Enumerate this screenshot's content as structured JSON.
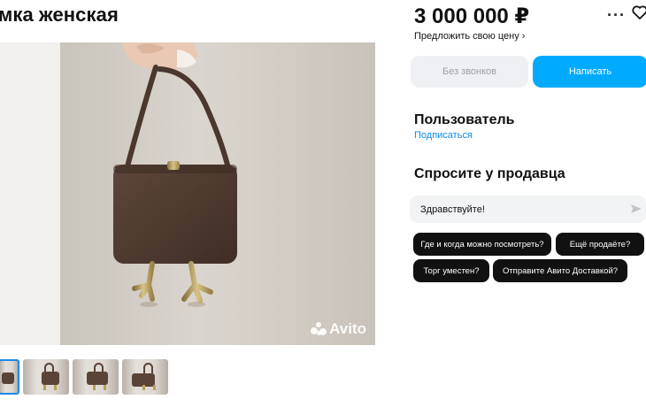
{
  "listing": {
    "title": "мка женская",
    "price": "3 000 000 ₽",
    "offer_link": "Предложить свою цену ›"
  },
  "actions": {
    "no_calls": "Без звонков",
    "write": "Написать"
  },
  "seller": {
    "name": "Пользователь",
    "subscribe": "Подписаться"
  },
  "ask": {
    "title": "Спросите у продавца",
    "message": "Здравствуйте!",
    "chips": [
      "Где и когда можно посмотреть?",
      "Ещё продаёте?",
      "Торг уместен?",
      "Отправите Авито Доставкой?"
    ]
  },
  "gallery": {
    "watermark": "Avito",
    "thumbnail_count": 4,
    "selected_thumbnail": 1
  },
  "colors": {
    "accent": "#00aaff",
    "link": "#0a8ee6",
    "chip_bg": "#111111",
    "soft_button_bg": "#eef0f3"
  },
  "icons": [
    "more-icon",
    "heart-icon",
    "send-icon",
    "avito-logo-icon"
  ]
}
